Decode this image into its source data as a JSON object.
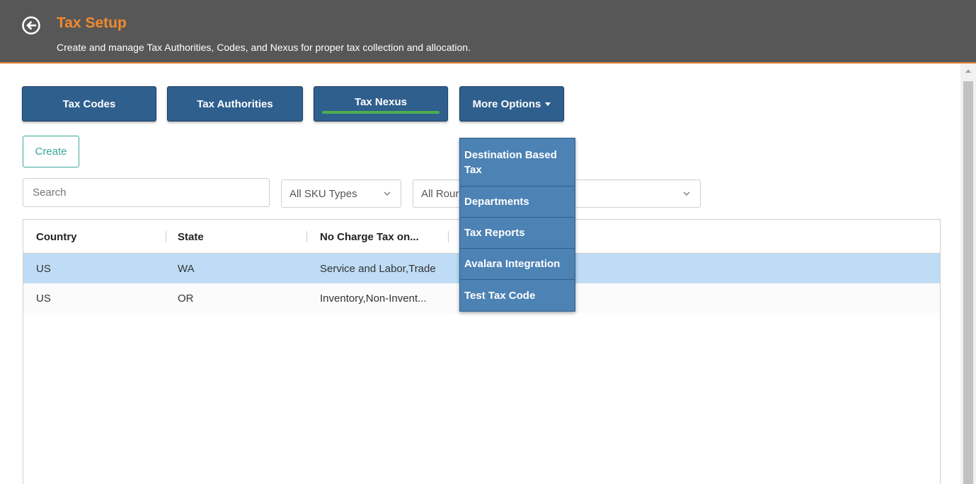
{
  "header": {
    "title": "Tax Setup",
    "subtitle": "Create and manage Tax Authorities, Codes, and Nexus for proper tax collection and allocation.",
    "back_icon": "back-arrow-circle-icon"
  },
  "tabs": [
    {
      "label": "Tax Codes",
      "active": false
    },
    {
      "label": "Tax Authorities",
      "active": false
    },
    {
      "label": "Tax Nexus",
      "active": true
    },
    {
      "label": "More Options",
      "active": false
    }
  ],
  "toolbar": {
    "create_label": "Create",
    "search_placeholder": "Search"
  },
  "filters": {
    "sku_types": "All SKU Types",
    "rounding": "All Rour"
  },
  "grid": {
    "columns": [
      "Country",
      "State",
      "No Charge Tax on..."
    ],
    "rows": [
      {
        "country": "US",
        "state": "WA",
        "no_charge": "Service and Labor,Trade",
        "selected": true
      },
      {
        "country": "US",
        "state": "OR",
        "no_charge": "Inventory,Non-Invent...",
        "selected": false
      }
    ]
  },
  "more_options_menu": [
    "Destination Based Tax",
    "Departments",
    "Tax Reports",
    "Avalara Integration",
    "Test Tax Code"
  ],
  "colors": {
    "header_bg": "#575757",
    "title": "#f2892e",
    "tab_bg": "#2f5f8d",
    "active_underline": "#4caf50",
    "create_accent": "#3aa79a",
    "selected_row": "#bedcf5",
    "menu_bg": "#4d82b4"
  }
}
